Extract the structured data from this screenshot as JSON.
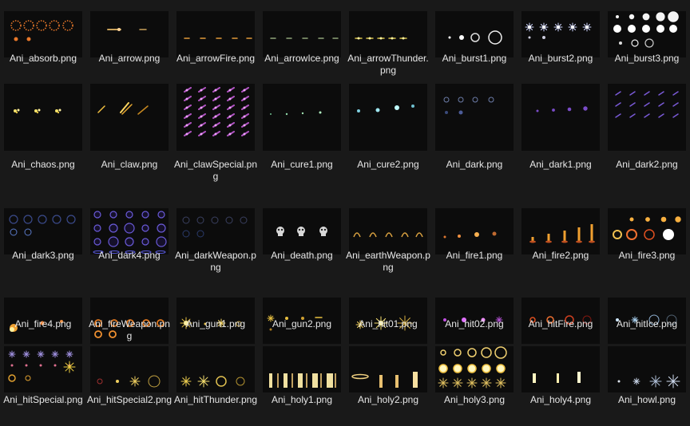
{
  "files": [
    {
      "name": "Ani_absorb.png",
      "thumb": "absorb"
    },
    {
      "name": "Ani_arrow.png",
      "thumb": "arrow"
    },
    {
      "name": "Ani_arrowFire.png",
      "thumb": "arrowFire"
    },
    {
      "name": "Ani_arrowIce.png",
      "thumb": "arrowIce"
    },
    {
      "name": "Ani_arrowThunder.png",
      "thumb": "arrowThunder"
    },
    {
      "name": "Ani_burst1.png",
      "thumb": "burst1"
    },
    {
      "name": "Ani_burst2.png",
      "thumb": "burst2"
    },
    {
      "name": "Ani_burst3.png",
      "thumb": "burst3"
    },
    {
      "name": "Ani_chaos.png",
      "thumb": "chaos"
    },
    {
      "name": "Ani_claw.png",
      "thumb": "claw"
    },
    {
      "name": "Ani_clawSpecial.png",
      "thumb": "clawSpecial"
    },
    {
      "name": "Ani_cure1.png",
      "thumb": "cure1"
    },
    {
      "name": "Ani_cure2.png",
      "thumb": "cure2"
    },
    {
      "name": "Ani_dark.png",
      "thumb": "dark"
    },
    {
      "name": "Ani_dark1.png",
      "thumb": "dark1"
    },
    {
      "name": "Ani_dark2.png",
      "thumb": "dark2"
    },
    {
      "name": "Ani_dark3.png",
      "thumb": "dark3"
    },
    {
      "name": "Ani_dark4.png",
      "thumb": "dark4"
    },
    {
      "name": "Ani_darkWeapon.png",
      "thumb": "darkWeapon"
    },
    {
      "name": "Ani_death.png",
      "thumb": "death"
    },
    {
      "name": "Ani_earthWeapon.png",
      "thumb": "earthWeapon"
    },
    {
      "name": "Ani_fire1.png",
      "thumb": "fire1"
    },
    {
      "name": "Ani_fire2.png",
      "thumb": "fire2"
    },
    {
      "name": "Ani_fire3.png",
      "thumb": "fire3"
    },
    {
      "name": "Ani_fire4.png",
      "thumb": "fire4"
    },
    {
      "name": "Ani_fireWeapon.png",
      "thumb": "fireWeapon"
    },
    {
      "name": "Ani_gun1.png",
      "thumb": "gun1"
    },
    {
      "name": "Ani_gun2.png",
      "thumb": "gun2"
    },
    {
      "name": "Ani_hit01.png",
      "thumb": "hit01"
    },
    {
      "name": "Ani_hit02.png",
      "thumb": "hit02"
    },
    {
      "name": "Ani_hitFire.png",
      "thumb": "hitFire"
    },
    {
      "name": "Ani_hitIce.png",
      "thumb": "hitIce"
    },
    {
      "name": "Ani_hitSpecial.png",
      "thumb": "hitSpecial"
    },
    {
      "name": "Ani_hitSpecial2.png",
      "thumb": "hitSpecial2"
    },
    {
      "name": "Ani_hitThunder.png",
      "thumb": "hitThunder"
    },
    {
      "name": "Ani_holy1.png",
      "thumb": "holy1"
    },
    {
      "name": "Ani_holy2.png",
      "thumb": "holy2"
    },
    {
      "name": "Ani_holy3.png",
      "thumb": "holy3"
    },
    {
      "name": "Ani_holy4.png",
      "thumb": "holy4"
    },
    {
      "name": "Ani_howl.png",
      "thumb": "howl"
    }
  ]
}
